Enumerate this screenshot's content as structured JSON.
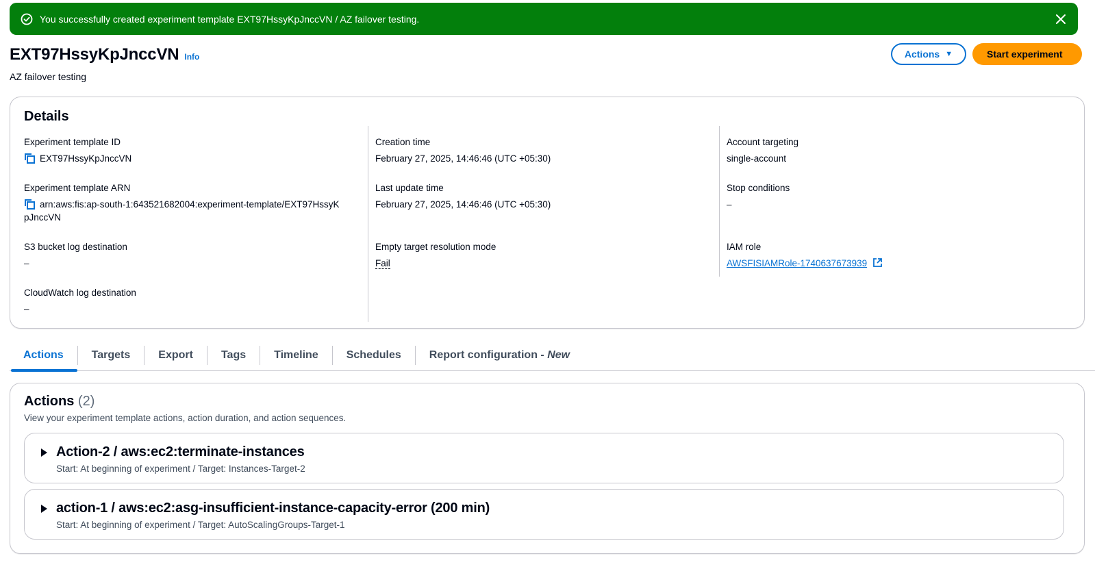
{
  "flash": {
    "message": "You successfully created experiment template EXT97HssyKpJnccVN / AZ failover testing."
  },
  "header": {
    "title": "EXT97HssyKpJnccVN",
    "info_label": "Info",
    "subtitle": "AZ failover testing",
    "actions_label": "Actions",
    "start_label": "Start experiment"
  },
  "details": {
    "heading": "Details",
    "template_id": {
      "label": "Experiment template ID",
      "value": "EXT97HssyKpJnccVN"
    },
    "template_arn": {
      "label": "Experiment template ARN",
      "value_line1": "arn:aws:fis:ap-south-1:643521682004:experiment-template/EXT97HssyK",
      "value_line2": "pJnccVN"
    },
    "s3_log": {
      "label": "S3 bucket log destination",
      "value": "–"
    },
    "cloudwatch_log": {
      "label": "CloudWatch log destination",
      "value": "–"
    },
    "creation_time": {
      "label": "Creation time",
      "value": "February 27, 2025, 14:46:46 (UTC +05:30)"
    },
    "last_update_time": {
      "label": "Last update time",
      "value": "February 27, 2025, 14:46:46 (UTC +05:30)"
    },
    "empty_target_mode": {
      "label": "Empty target resolution mode",
      "value": "Fail"
    },
    "account_targeting": {
      "label": "Account targeting",
      "value": "single-account"
    },
    "stop_conditions": {
      "label": "Stop conditions",
      "value": "–"
    },
    "iam_role": {
      "label": "IAM role",
      "value": "AWSFISIAMRole-1740637673939"
    }
  },
  "tabs": [
    {
      "label": "Actions"
    },
    {
      "label": "Targets"
    },
    {
      "label": "Export"
    },
    {
      "label": "Tags"
    },
    {
      "label": "Timeline"
    },
    {
      "label": "Schedules"
    },
    {
      "label": "Report configuration - ",
      "suffix": "New"
    }
  ],
  "actions_panel": {
    "heading": "Actions",
    "count": "(2)",
    "description": "View your experiment template actions, action duration, and action sequences.",
    "items": [
      {
        "title": "Action-2 / aws:ec2:terminate-instances",
        "subtitle": "Start: At beginning of experiment / Target: Instances-Target-2"
      },
      {
        "title": "action-1 / aws:ec2:asg-insufficient-instance-capacity-error (200 min)",
        "subtitle": "Start: At beginning of experiment / Target: AutoScalingGroups-Target-1"
      }
    ]
  },
  "colors": {
    "success": "#037f0c",
    "link": "#0972d3",
    "primary_button": "#ff9900",
    "border": "#c6c6cd"
  },
  "icons": {
    "flash": "check-circle-icon",
    "close": "close-icon",
    "copy": "copy-icon",
    "external": "external-link-icon",
    "expand": "caret-right-icon"
  }
}
